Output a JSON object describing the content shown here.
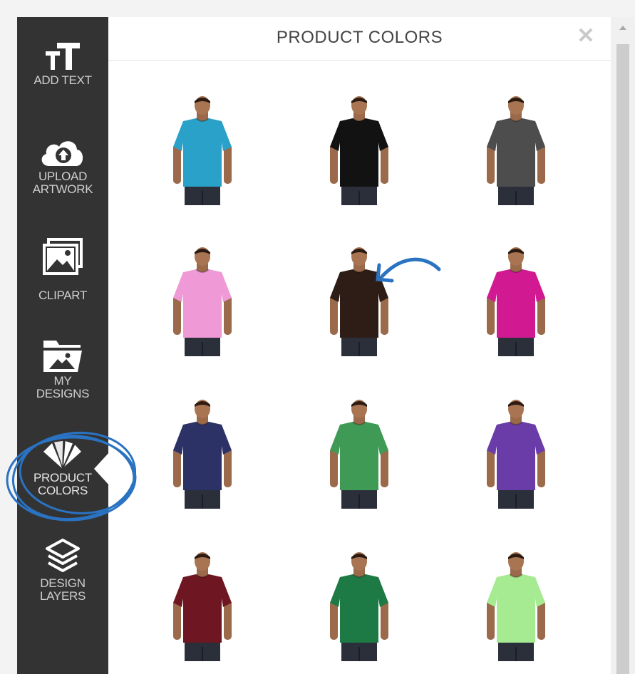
{
  "panel": {
    "title": "PRODUCT COLORS",
    "close_icon": "close-icon"
  },
  "sidebar": {
    "items": [
      {
        "label": "ADD TEXT",
        "icon": "text-size-icon"
      },
      {
        "label_line1": "UPLOAD",
        "label_line2": "ARTWORK",
        "icon": "cloud-upload-icon"
      },
      {
        "label": "CLIPART",
        "icon": "image-gallery-icon"
      },
      {
        "label_line1": "MY",
        "label_line2": "DESIGNS",
        "icon": "folder-image-icon"
      },
      {
        "label_line1": "PRODUCT",
        "label_line2": "COLORS",
        "icon": "color-swatch-fan-icon",
        "active": true
      },
      {
        "label_line1": "DESIGN",
        "label_line2": "LAYERS",
        "icon": "layers-icon"
      }
    ]
  },
  "colors": {
    "swatches": [
      {
        "color": "#2aa1c9"
      },
      {
        "color": "#121212"
      },
      {
        "color": "#4d4d4d"
      },
      {
        "color": "#ef99d6"
      },
      {
        "color": "#2e1d17"
      },
      {
        "color": "#d11a92"
      },
      {
        "color": "#2c3266"
      },
      {
        "color": "#3f9a55"
      },
      {
        "color": "#6a3ca8"
      },
      {
        "color": "#6e1722"
      },
      {
        "color": "#1d7a45"
      },
      {
        "color": "#a6eb92"
      }
    ]
  },
  "annotation_color": "#2a73c2"
}
